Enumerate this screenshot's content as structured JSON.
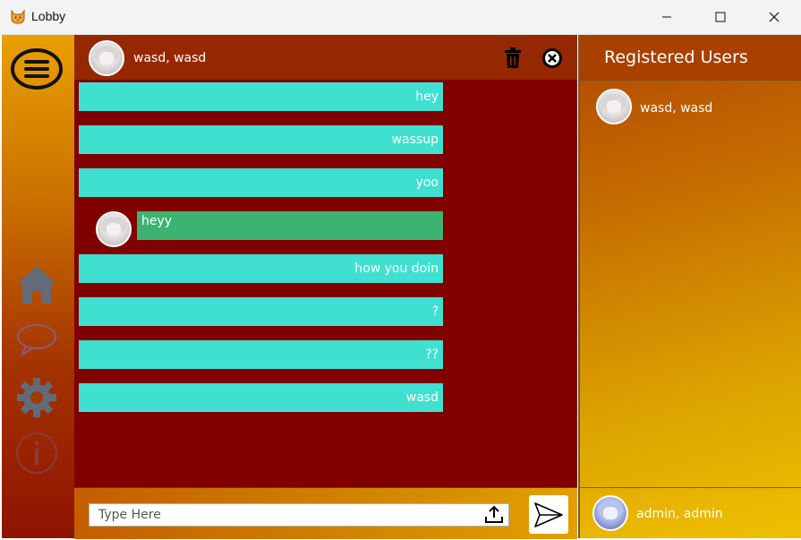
{
  "window": {
    "title": "Lobby",
    "app_icon": "cat-icon"
  },
  "sidebar": {
    "items": [
      {
        "name": "menu",
        "icon": "hamburger-menu-icon"
      },
      {
        "name": "home",
        "icon": "home-icon"
      },
      {
        "name": "chat",
        "icon": "chat-bubble-icon"
      },
      {
        "name": "settings",
        "icon": "gear-icon"
      },
      {
        "name": "info",
        "icon": "info-icon"
      }
    ]
  },
  "chat": {
    "header_name": "wasd, wasd",
    "delete_icon": "trash-icon",
    "close_icon": "close-circle-icon",
    "messages": [
      {
        "text": "hey",
        "direction": "outgoing"
      },
      {
        "text": "wassup",
        "direction": "outgoing"
      },
      {
        "text": "yoo",
        "direction": "outgoing"
      },
      {
        "text": "heyy",
        "direction": "incoming"
      },
      {
        "text": "how you doin",
        "direction": "outgoing"
      },
      {
        "text": "?",
        "direction": "outgoing"
      },
      {
        "text": "??",
        "direction": "outgoing"
      },
      {
        "text": "wasd",
        "direction": "outgoing"
      }
    ],
    "input": {
      "placeholder": "Type Here",
      "value": ""
    },
    "upload_icon": "upload-icon",
    "send_icon": "send-icon"
  },
  "users": {
    "title": "Registered Users",
    "list": [
      {
        "name": "wasd, wasd"
      }
    ],
    "current_user": "admin, admin"
  },
  "colors": {
    "chat_background": "#800000",
    "outgoing_bubble": "#40e0d0",
    "incoming_bubble": "#3cb371",
    "header_background": "#962800"
  }
}
